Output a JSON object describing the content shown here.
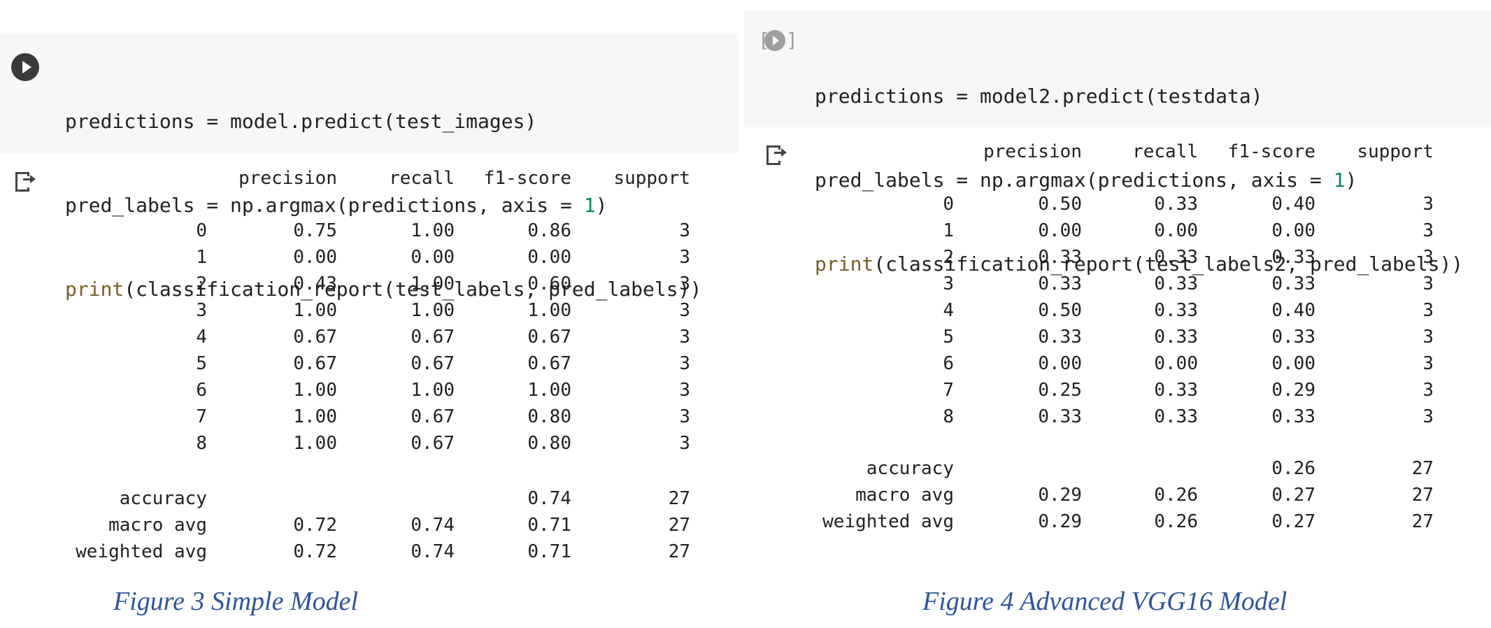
{
  "left": {
    "code": {
      "line1": "predictions = model.predict(test_images)",
      "line2_pre": "pred_labels = np.argmax(predictions, axis = ",
      "line2_num": "1",
      "line2_post": ")",
      "line3_print": "print",
      "line3_post": "(classification_report(test_labels, pred_labels))"
    },
    "report": {
      "headers": [
        "precision",
        "recall",
        "f1-score",
        "support"
      ],
      "rows": [
        [
          "0",
          "0.75",
          "1.00",
          "0.86",
          "3"
        ],
        [
          "1",
          "0.00",
          "0.00",
          "0.00",
          "3"
        ],
        [
          "2",
          "0.43",
          "1.00",
          "0.60",
          "3"
        ],
        [
          "3",
          "1.00",
          "1.00",
          "1.00",
          "3"
        ],
        [
          "4",
          "0.67",
          "0.67",
          "0.67",
          "3"
        ],
        [
          "5",
          "0.67",
          "0.67",
          "0.67",
          "3"
        ],
        [
          "6",
          "1.00",
          "1.00",
          "1.00",
          "3"
        ],
        [
          "7",
          "1.00",
          "0.67",
          "0.80",
          "3"
        ],
        [
          "8",
          "1.00",
          "0.67",
          "0.80",
          "3"
        ]
      ],
      "summary": [
        [
          "accuracy",
          "",
          "",
          "0.74",
          "27"
        ],
        [
          "macro avg",
          "0.72",
          "0.74",
          "0.71",
          "27"
        ],
        [
          "weighted avg",
          "0.72",
          "0.74",
          "0.71",
          "27"
        ]
      ]
    },
    "caption": "Figure 3 Simple Model"
  },
  "right": {
    "code": {
      "line1": "predictions = model2.predict(testdata)",
      "line2_pre": "pred_labels = np.argmax(predictions, axis = ",
      "line2_num": "1",
      "line2_post": ")",
      "line3_print": "print",
      "line3_post": "(classification_report(test_labels2, pred_labels))"
    },
    "report": {
      "headers": [
        "precision",
        "recall",
        "f1-score",
        "support"
      ],
      "rows": [
        [
          "0",
          "0.50",
          "0.33",
          "0.40",
          "3"
        ],
        [
          "1",
          "0.00",
          "0.00",
          "0.00",
          "3"
        ],
        [
          "2",
          "0.33",
          "0.33",
          "0.33",
          "3"
        ],
        [
          "3",
          "0.33",
          "0.33",
          "0.33",
          "3"
        ],
        [
          "4",
          "0.50",
          "0.33",
          "0.40",
          "3"
        ],
        [
          "5",
          "0.33",
          "0.33",
          "0.33",
          "3"
        ],
        [
          "6",
          "0.00",
          "0.00",
          "0.00",
          "3"
        ],
        [
          "7",
          "0.25",
          "0.33",
          "0.29",
          "3"
        ],
        [
          "8",
          "0.33",
          "0.33",
          "0.33",
          "3"
        ]
      ],
      "summary": [
        [
          "accuracy",
          "",
          "",
          "0.26",
          "27"
        ],
        [
          "macro avg",
          "0.29",
          "0.26",
          "0.27",
          "27"
        ],
        [
          "weighted avg",
          "0.29",
          "0.26",
          "0.27",
          "27"
        ]
      ]
    },
    "caption": "Figure 4 Advanced VGG16 Model"
  },
  "colors": {
    "cell_background": "#f7f7f7",
    "print_keyword": "#795e26",
    "number_literal": "#09885a",
    "caption": "#2f5496"
  }
}
